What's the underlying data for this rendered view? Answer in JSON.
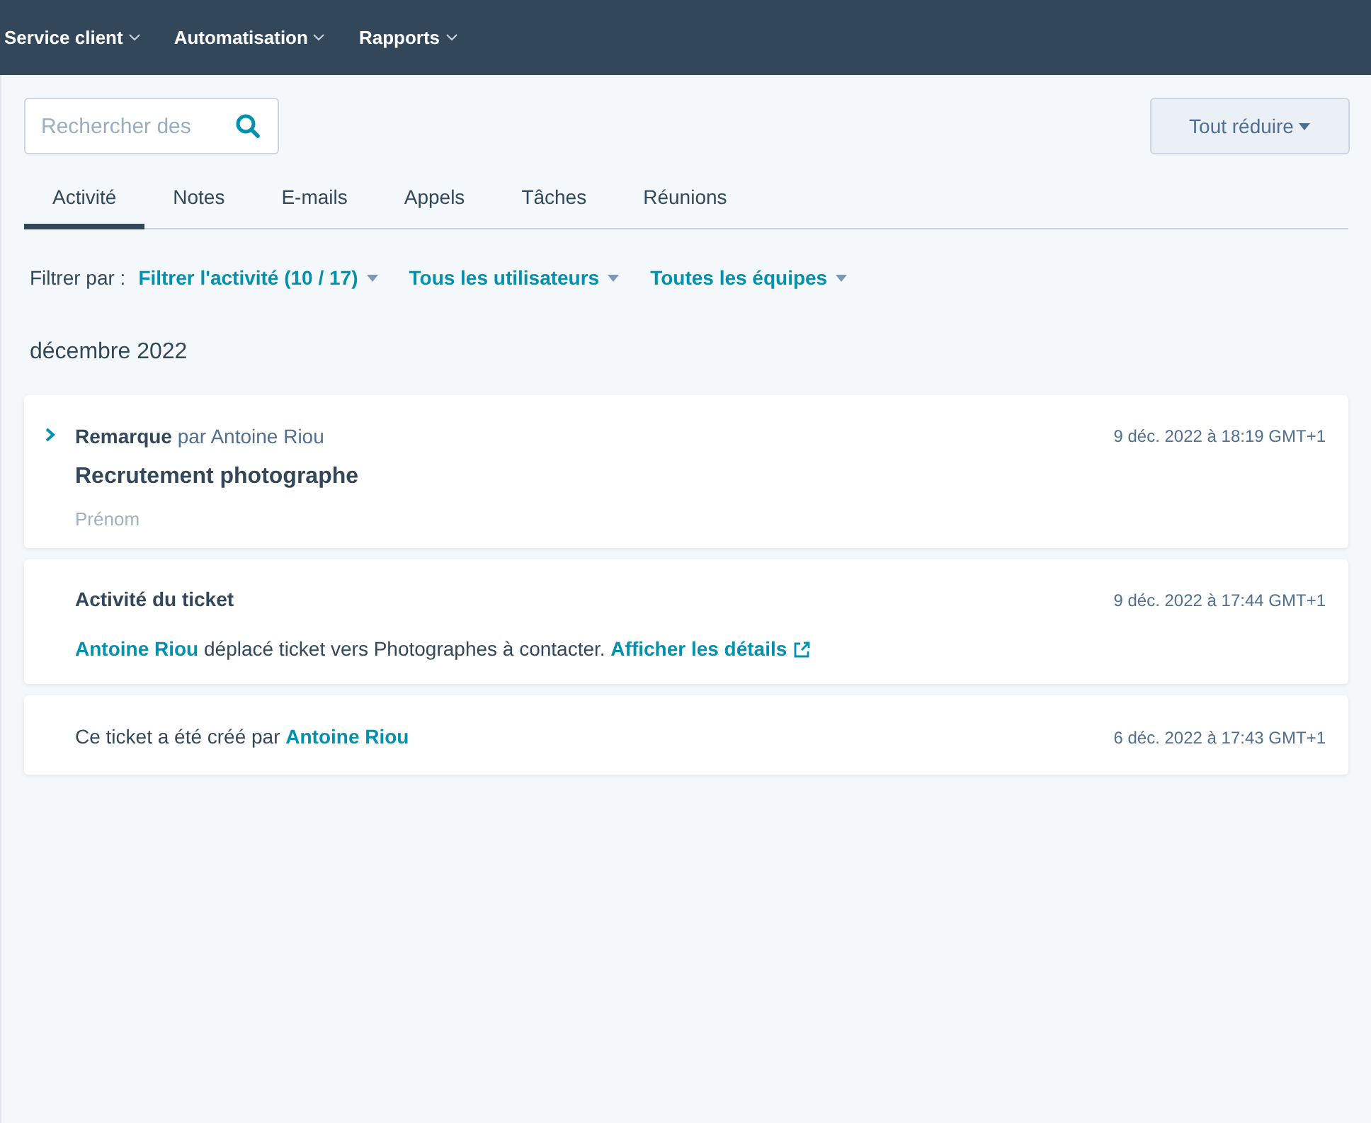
{
  "top_nav": [
    {
      "label": "Service client"
    },
    {
      "label": "Automatisation"
    },
    {
      "label": "Rapports"
    }
  ],
  "search": {
    "placeholder": "Rechercher des"
  },
  "collapse_button": {
    "label": "Tout réduire"
  },
  "tabs": [
    {
      "label": "Activité",
      "selected": true
    },
    {
      "label": "Notes",
      "selected": false
    },
    {
      "label": "E-mails",
      "selected": false
    },
    {
      "label": "Appels",
      "selected": false
    },
    {
      "label": "Tâches",
      "selected": false
    },
    {
      "label": "Réunions",
      "selected": false
    }
  ],
  "filters": {
    "label": "Filtrer par :",
    "dropdowns": [
      {
        "label": "Filtrer l'activité (10 / 17)"
      },
      {
        "label": "Tous les utilisateurs"
      },
      {
        "label": "Toutes les équipes"
      }
    ]
  },
  "month": "décembre 2022",
  "activities": [
    {
      "kind": "note",
      "expanded": false,
      "header": [
        {
          "kind": "bold",
          "text": "Remarque"
        },
        {
          "kind": "text",
          "text": " par Antoine Riou"
        }
      ],
      "title": "Recrutement photographe",
      "preview": "Prénom",
      "time": "9 déc. 2022 à 18:19 GMT+1"
    },
    {
      "kind": "ticket_activity",
      "heading": "Activité du ticket",
      "body": [
        {
          "kind": "link",
          "text": "Antoine Riou"
        },
        {
          "kind": "text",
          "text": " déplacé ticket vers Photographes à contacter. "
        },
        {
          "kind": "external_link",
          "text": "Afficher les détails"
        }
      ],
      "time": "9 déc. 2022 à 17:44 GMT+1"
    },
    {
      "kind": "created",
      "body": [
        {
          "kind": "text",
          "text": "Ce ticket a été créé par "
        },
        {
          "kind": "link",
          "text": "Antoine Riou"
        }
      ],
      "time": "6 déc. 2022 à 17:43 GMT+1"
    }
  ]
}
